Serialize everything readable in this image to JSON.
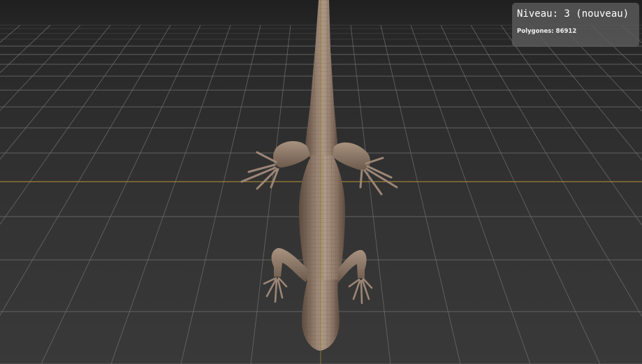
{
  "viewport": {
    "background_color": "#2e2e2e",
    "grid_color": "#6e6e6e",
    "horizon_axis_color": "#b8923a",
    "vertical_axis_color": "#8a7a2a",
    "model": "lizard-mesh"
  },
  "hud": {
    "level_text": "Niveau: 3 (nouveau)",
    "polygon_text": "Polygones: 86912"
  },
  "model_colors": {
    "skin_light": "#b09a88",
    "skin_mid": "#8d7767",
    "skin_dark": "#5e4c40",
    "wire": "#6b574a"
  }
}
